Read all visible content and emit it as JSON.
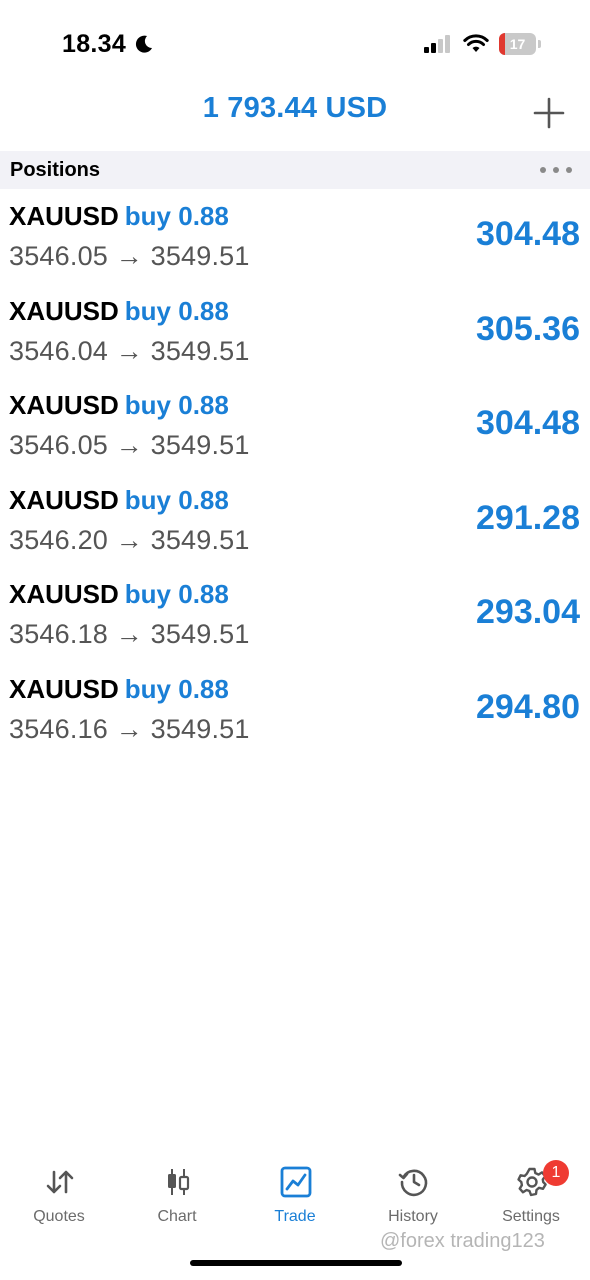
{
  "status_bar": {
    "time": "18.34",
    "battery_level": "17",
    "battery_color": "#e0382f"
  },
  "header": {
    "balance": "1 793.44 USD",
    "add_icon": "plus-icon"
  },
  "section": {
    "title": "Positions",
    "more_icon": "more-dots-icon"
  },
  "positions": [
    {
      "symbol": "XAUUSD",
      "type": "buy 0.88",
      "prices": "3546.05 → 3549.51",
      "profit": "304.48"
    },
    {
      "symbol": "XAUUSD",
      "type": "buy 0.88",
      "prices": "3546.04 → 3549.51",
      "profit": "305.36"
    },
    {
      "symbol": "XAUUSD",
      "type": "buy 0.88",
      "prices": "3546.05 → 3549.51",
      "profit": "304.48"
    },
    {
      "symbol": "XAUUSD",
      "type": "buy 0.88",
      "prices": "3546.20 → 3549.51",
      "profit": "291.28"
    },
    {
      "symbol": "XAUUSD",
      "type": "buy 0.88",
      "prices": "3546.18 → 3549.51",
      "profit": "293.04"
    },
    {
      "symbol": "XAUUSD",
      "type": "buy 0.88",
      "prices": "3546.16 → 3549.51",
      "profit": "294.80"
    }
  ],
  "tabs": [
    {
      "label": "Quotes",
      "icon": "quotes-arrows-icon",
      "active": false
    },
    {
      "label": "Chart",
      "icon": "candlestick-chart-icon",
      "active": false
    },
    {
      "label": "Trade",
      "icon": "trade-line-chart-icon",
      "active": true
    },
    {
      "label": "History",
      "icon": "history-clock-icon",
      "active": false
    },
    {
      "label": "Settings",
      "icon": "gear-icon",
      "active": false,
      "badge": "1"
    }
  ],
  "watermark": "@forex trading123",
  "colors": {
    "accent": "#1a7fd6",
    "badge": "#ef3b32",
    "section_bg": "#f2f2f7"
  }
}
